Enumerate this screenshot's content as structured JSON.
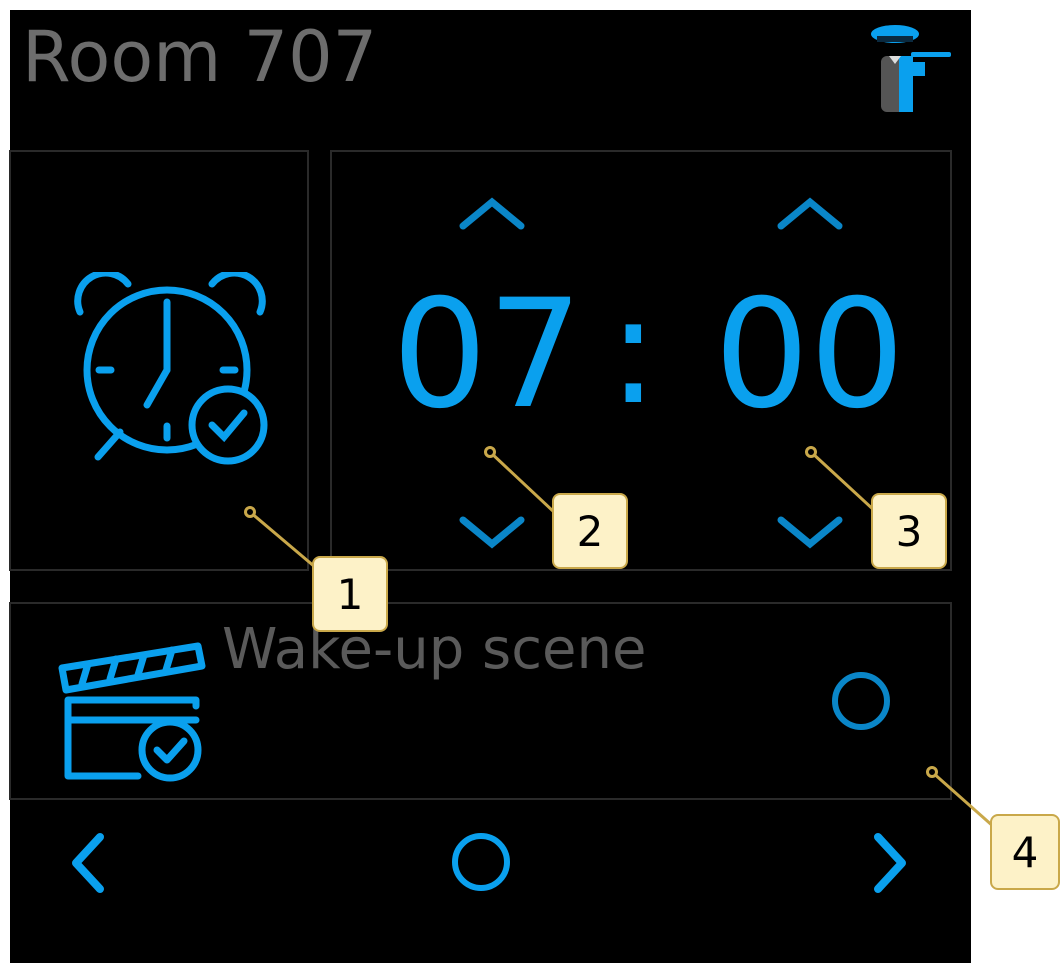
{
  "header": {
    "title": "Room 707",
    "logo_icon": "butler-logo-icon"
  },
  "alarm": {
    "icon": "alarm-clock-check-icon"
  },
  "time": {
    "hours": "07",
    "separator": ":",
    "minutes": "00",
    "increment_icon": "chevron-up-icon",
    "decrement_icon": "chevron-down-icon"
  },
  "scene": {
    "label": "Wake-up scene",
    "icon": "clapperboard-check-icon",
    "toggle_state": "off"
  },
  "nav": {
    "prev_icon": "chevron-left-icon",
    "home_icon": "home-circle-icon",
    "next_icon": "chevron-right-icon"
  },
  "callouts": [
    "1",
    "2",
    "3",
    "4"
  ],
  "colors": {
    "accent": "#0aa0ee",
    "title": "#6d6d6d",
    "callout_fill": "#fdf2c8",
    "callout_border": "#c9a84a"
  }
}
